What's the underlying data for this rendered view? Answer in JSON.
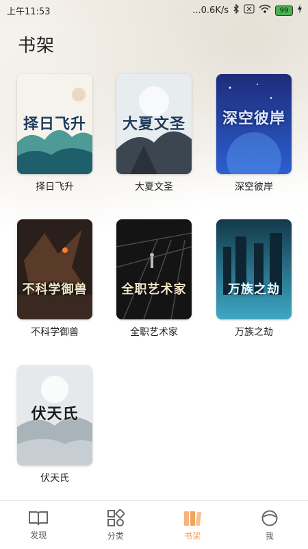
{
  "status_bar": {
    "time": "上午11:53",
    "network_speed": "...0.6K/s",
    "battery": "99"
  },
  "page": {
    "title": "书架"
  },
  "books": [
    {
      "title": "择日飞升",
      "cover_text": "择日飞升",
      "palette": [
        "#f5f3ec",
        "#2f8a87"
      ],
      "dark": false
    },
    {
      "title": "大夏文圣",
      "cover_text": "大夏文圣",
      "palette": [
        "#e7ecef",
        "#3b4650"
      ],
      "dark": false
    },
    {
      "title": "深空彼岸",
      "cover_text": "深空彼岸",
      "palette": [
        "#1e2c7a",
        "#2c5fd0"
      ],
      "dark": true
    },
    {
      "title": "不科学御兽",
      "cover_text": "不科学御兽",
      "palette": [
        "#3b2a22",
        "#a34f24"
      ],
      "dark": true
    },
    {
      "title": "全职艺术家",
      "cover_text": "全职艺术家",
      "palette": [
        "#141414",
        "#4a4a4a"
      ],
      "dark": true
    },
    {
      "title": "万族之劫",
      "cover_text": "万族之劫",
      "palette": [
        "#14394b",
        "#3ea7c4"
      ],
      "dark": true
    },
    {
      "title": "伏天氏",
      "cover_text": "伏天氏",
      "palette": [
        "#e6e9ec",
        "#9aa6ae"
      ],
      "dark": false
    }
  ],
  "tabs": [
    {
      "label": "发现",
      "icon": "book-open-icon",
      "active": false
    },
    {
      "label": "分类",
      "icon": "grid-shapes-icon",
      "active": false
    },
    {
      "label": "书架",
      "icon": "bookshelf-icon",
      "active": true,
      "active_color": "#f0a45c"
    },
    {
      "label": "我",
      "icon": "profile-icon",
      "active": false
    }
  ]
}
